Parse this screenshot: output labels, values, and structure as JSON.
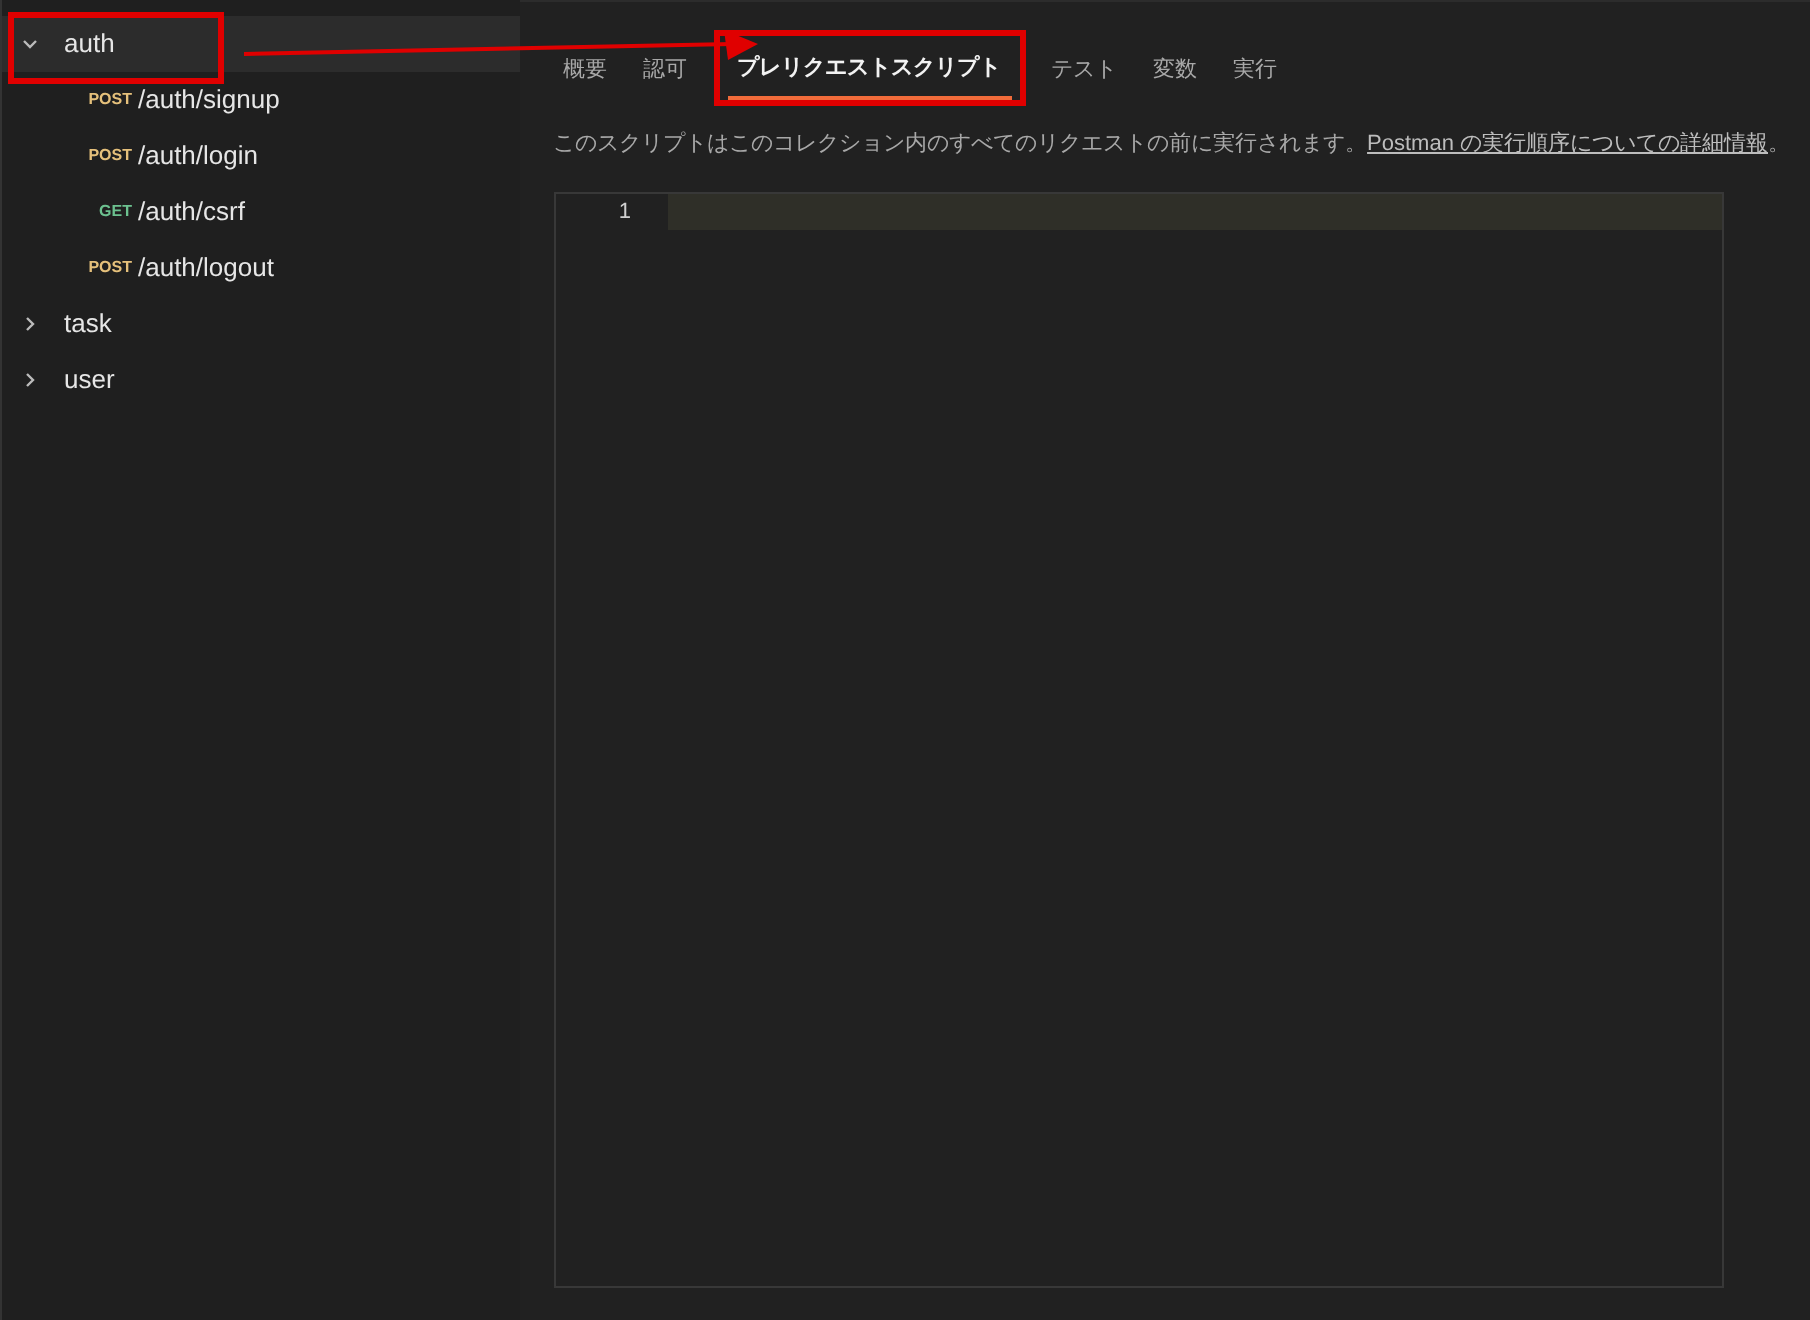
{
  "sidebar": {
    "items": [
      {
        "label": "auth",
        "expanded": true,
        "selected": true,
        "children": [
          {
            "method": "POST",
            "color": "#e5c07b",
            "path": "/auth/signup"
          },
          {
            "method": "POST",
            "color": "#e5c07b",
            "path": "/auth/login"
          },
          {
            "method": "GET",
            "color": "#6cc18f",
            "path": "/auth/csrf"
          },
          {
            "method": "POST",
            "color": "#e5c07b",
            "path": "/auth/logout"
          }
        ]
      },
      {
        "label": "task",
        "expanded": false,
        "selected": false
      },
      {
        "label": "user",
        "expanded": false,
        "selected": false
      }
    ]
  },
  "tabs": [
    {
      "label": "概要",
      "selected": false
    },
    {
      "label": "認可",
      "selected": false
    },
    {
      "label": "プレリクエストスクリプト",
      "selected": true
    },
    {
      "label": "テスト",
      "selected": false
    },
    {
      "label": "変数",
      "selected": false
    },
    {
      "label": "実行",
      "selected": false
    }
  ],
  "description": {
    "text": "このスクリプトはこのコレクション内のすべてのリクエストの前に実行されます。",
    "link": "Postman の実行順序についての詳細情報",
    "end": "。"
  },
  "editor": {
    "line_numbers": [
      "1"
    ]
  }
}
